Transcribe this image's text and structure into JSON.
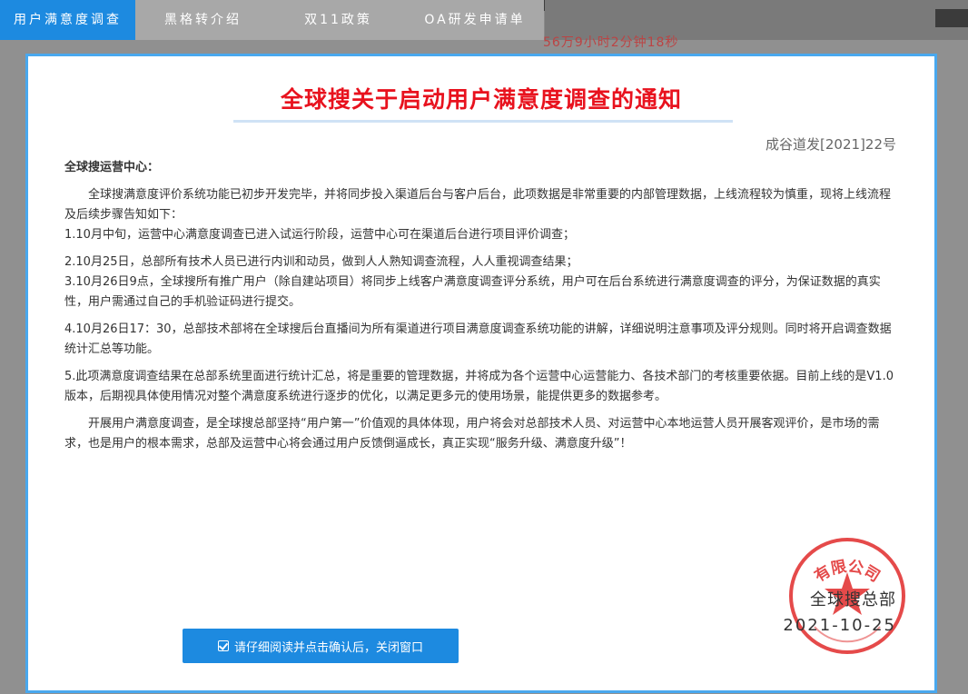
{
  "background": {
    "text": "56万9小时2分钟18秒"
  },
  "tabs": [
    {
      "label": "用户满意度调查",
      "active": true
    },
    {
      "label": "黑格转介绍",
      "active": false
    },
    {
      "label": "双11政策",
      "active": false
    },
    {
      "label": "OA研发申请单",
      "active": false
    }
  ],
  "notice": {
    "title": "全球搜关于启动用户满意度调查的通知",
    "doc_number": "成谷道发[2021]22号",
    "recipient": "全球搜运营中心：",
    "paragraphs": [
      "全球搜满意度评价系统功能已初步开发完毕，并将同步投入渠道后台与客户后台，此项数据是非常重要的内部管理数据，上线流程较为慎重，现将上线流程及后续步骤告知如下：",
      "1.10月中旬，运营中心满意度调查已进入试运行阶段，运营中心可在渠道后台进行项目评价调查；",
      "2.10月25日，总部所有技术人员已进行内训和动员，做到人人熟知调查流程，人人重视调查结果；",
      "3.10月26日9点，全球搜所有推广用户（除自建站项目）将同步上线客户满意度调查评分系统，用户可在后台系统进行满意度调查的评分，为保证数据的真实性，用户需通过自己的手机验证码进行提交。",
      "4.10月26日17：30，总部技术部将在全球搜后台直播间为所有渠道进行项目满意度调查系统功能的讲解，详细说明注意事项及评分规则。同时将开启调查数据统计汇总等功能。",
      "5.此项满意度调查结果在总部系统里面进行统计汇总，将是重要的管理数据，并将成为各个运营中心运营能力、各技术部门的考核重要依据。目前上线的是V1.0版本，后期视具体使用情况对整个满意度系统进行逐步的优化，以满足更多元的使用场景，能提供更多的数据参考。",
      "开展用户满意度调查，是全球搜总部坚持“用户第一”价值观的具体体现，用户将会对总部技术人员、对运营中心本地运营人员开展客观评价，是市场的需求，也是用户的根本需求，总部及运营中心将会通过用户反馈倒逼成长，真正实现“服务升级、满意度升级”！"
    ],
    "signature_org": "全球搜总部",
    "signature_date": "2021-10-25",
    "stamp_text": "有限公司"
  },
  "confirm_button": {
    "label": "请仔细阅读并点击确认后，关闭窗口",
    "icon": "checkbox-icon"
  },
  "colors": {
    "accent": "#1d8ae0",
    "title_red": "#e8121e",
    "modal_border": "#49a8ee",
    "stamp_red": "#e02a2a"
  }
}
